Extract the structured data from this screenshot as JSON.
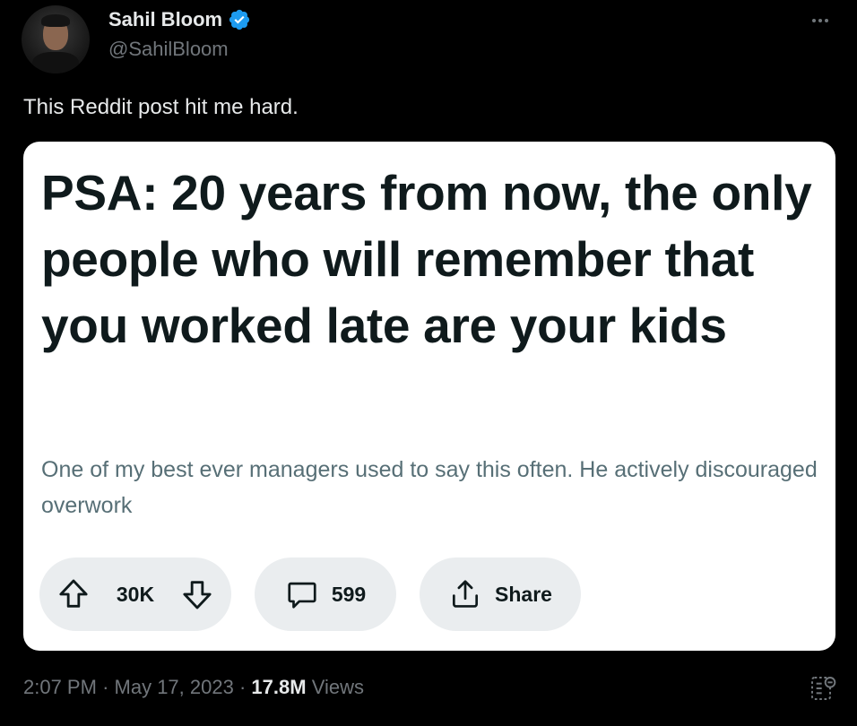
{
  "author": {
    "name": "Sahil Bloom",
    "handle": "@SahilBloom",
    "verified": true,
    "verified_color": "#1d9bf0"
  },
  "tweet": {
    "text": "This Reddit post hit me hard."
  },
  "reddit_post": {
    "title": "PSA: 20 years from now, the only people who will remember that you worked late are your kids",
    "body": "One of my best ever managers used to say this often. He actively discouraged overwork",
    "votes": "30K",
    "comments": "599",
    "share_label": "Share"
  },
  "meta": {
    "time": "2:07 PM",
    "separator": "·",
    "date": "May 17, 2023",
    "views_count": "17.8M",
    "views_label": "Views"
  },
  "icons": {
    "more": "more-icon",
    "verified": "verified-badge-icon",
    "upvote": "upvote-arrow-icon",
    "downvote": "downvote-arrow-icon",
    "comment": "comment-bubble-icon",
    "share": "share-icon",
    "analytics": "analytics-icon"
  }
}
